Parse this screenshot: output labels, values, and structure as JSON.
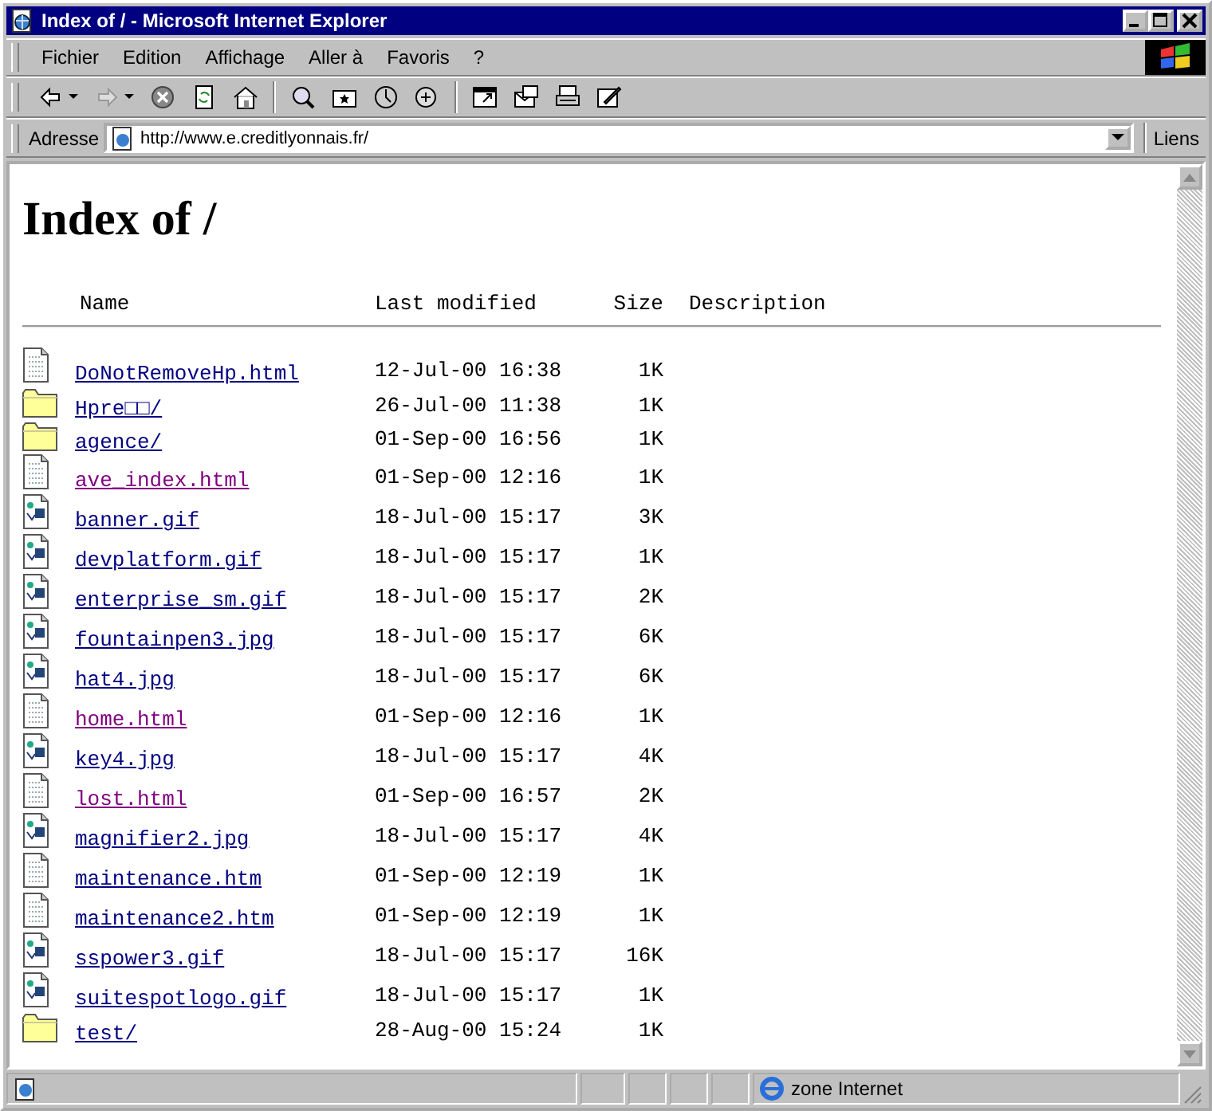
{
  "window": {
    "title": "Index of / - Microsoft Internet Explorer"
  },
  "menu": [
    "Fichier",
    "Edition",
    "Affichage",
    "Aller à",
    "Favoris",
    "?"
  ],
  "address_bar": {
    "label": "Adresse",
    "url": "http://www.e.creditlyonnais.fr/",
    "links_label": "Liens"
  },
  "page": {
    "heading": "Index of /",
    "columns": [
      "Name",
      "Last modified",
      "Size",
      "Description"
    ],
    "rows": [
      {
        "kind": "html",
        "name": "DoNotRemoveHp.html",
        "visited": false,
        "modified": "12-Jul-00 16:38",
        "size": "1K"
      },
      {
        "kind": "folder",
        "name": "Hpre□□/",
        "visited": false,
        "modified": "26-Jul-00 11:38",
        "size": "1K"
      },
      {
        "kind": "folder",
        "name": "agence/",
        "visited": false,
        "modified": "01-Sep-00 16:56",
        "size": "1K"
      },
      {
        "kind": "html",
        "name": "ave_index.html",
        "visited": true,
        "modified": "01-Sep-00 12:16",
        "size": "1K"
      },
      {
        "kind": "image",
        "name": "banner.gif",
        "visited": false,
        "modified": "18-Jul-00 15:17",
        "size": "3K"
      },
      {
        "kind": "image",
        "name": "devplatform.gif",
        "visited": false,
        "modified": "18-Jul-00 15:17",
        "size": "1K"
      },
      {
        "kind": "image",
        "name": "enterprise_sm.gif",
        "visited": false,
        "modified": "18-Jul-00 15:17",
        "size": "2K"
      },
      {
        "kind": "image",
        "name": "fountainpen3.jpg",
        "visited": false,
        "modified": "18-Jul-00 15:17",
        "size": "6K"
      },
      {
        "kind": "image",
        "name": "hat4.jpg",
        "visited": false,
        "modified": "18-Jul-00 15:17",
        "size": "6K"
      },
      {
        "kind": "html",
        "name": "home.html",
        "visited": true,
        "modified": "01-Sep-00 12:16",
        "size": "1K"
      },
      {
        "kind": "image",
        "name": "key4.jpg",
        "visited": false,
        "modified": "18-Jul-00 15:17",
        "size": "4K"
      },
      {
        "kind": "html",
        "name": "lost.html",
        "visited": true,
        "modified": "01-Sep-00 16:57",
        "size": "2K"
      },
      {
        "kind": "image",
        "name": "magnifier2.jpg",
        "visited": false,
        "modified": "18-Jul-00 15:17",
        "size": "4K"
      },
      {
        "kind": "html",
        "name": "maintenance.htm",
        "visited": false,
        "modified": "01-Sep-00 12:19",
        "size": "1K"
      },
      {
        "kind": "html",
        "name": "maintenance2.htm",
        "visited": false,
        "modified": "01-Sep-00 12:19",
        "size": "1K"
      },
      {
        "kind": "image",
        "name": "sspower3.gif",
        "visited": false,
        "modified": "18-Jul-00 15:17",
        "size": "16K"
      },
      {
        "kind": "image",
        "name": "suitespotlogo.gif",
        "visited": false,
        "modified": "18-Jul-00 15:17",
        "size": "1K"
      },
      {
        "kind": "folder",
        "name": "test/",
        "visited": false,
        "modified": "28-Aug-00 15:24",
        "size": "1K"
      }
    ]
  },
  "status_bar": {
    "zone": "zone Internet"
  }
}
